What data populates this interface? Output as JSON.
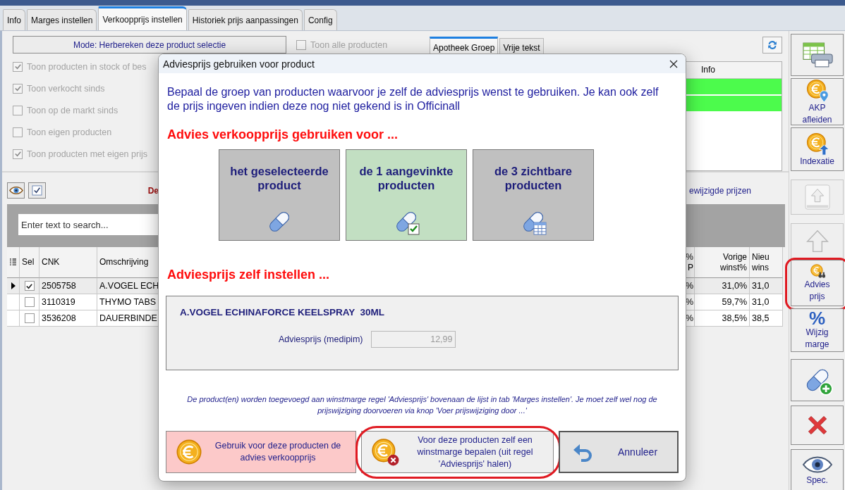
{
  "app_tabs": [
    {
      "label": "Info",
      "selected": false
    },
    {
      "label": "Marges instellen",
      "selected": false
    },
    {
      "label": "Verkoopprijs instellen",
      "selected": true
    },
    {
      "label": "Historiek prijs aanpassingen",
      "selected": false
    },
    {
      "label": "Config",
      "selected": false
    }
  ],
  "mode_button": "Mode: Herbereken deze product selectie",
  "show_all": {
    "label": "Toon alle producten",
    "checked": false,
    "disabled": true
  },
  "filters": [
    {
      "label": "Toon producten in stock of bes",
      "checked": true,
      "disabled": true
    },
    {
      "label": "Toon verkocht sinds",
      "checked": true,
      "disabled": true
    },
    {
      "label": "Toon op de markt sinds",
      "checked": false,
      "disabled": true
    },
    {
      "label": "Toon eigen producten",
      "checked": false,
      "disabled": true
    },
    {
      "label": "Toon producten met eigen prijs",
      "checked": true,
      "disabled": true
    }
  ],
  "group_tabs": [
    {
      "label": "Apotheek Groep",
      "selected": true
    },
    {
      "label": "Vrije tekst",
      "selected": false
    }
  ],
  "info_table": {
    "column": "Info",
    "rows": [
      {
        "color": "#4cfb4c"
      },
      {
        "color": "#4cfb4c"
      }
    ]
  },
  "list_toolbar": {
    "notice_start": "De",
    "notice_end": "ewijzigde prijzen"
  },
  "search": {
    "placeholder": "Enter text to search..."
  },
  "products": {
    "columns": [
      {
        "lines": [
          "Sel"
        ]
      },
      {
        "lines": [
          "CNK"
        ]
      },
      {
        "lines": [
          "Omschrijving"
        ]
      },
      {
        "lines": [
          "%",
          "P"
        ]
      },
      {
        "lines": [
          "Vorige",
          "winst%"
        ]
      },
      {
        "lines": [
          "Nieu",
          "wins"
        ]
      }
    ],
    "rows": [
      {
        "current": true,
        "checked": true,
        "cnk": "2505758",
        "description": "A.VOGEL ECH",
        "pct": "%",
        "previous": "31,0%",
        "new": "31,0"
      },
      {
        "current": false,
        "checked": false,
        "cnk": "3110319",
        "description": "THYMO TABS",
        "pct": "%",
        "previous": "59,7%",
        "new": "31,0"
      },
      {
        "current": false,
        "checked": false,
        "cnk": "3536208",
        "description": "DAUERBINDE",
        "pct": "%",
        "previous": "38,5%",
        "new": "38,5"
      }
    ]
  },
  "side_toolbar": [
    [
      {
        "kind": "print-table",
        "disabled": false
      },
      {
        "kind": "coin-pin",
        "lines": [
          "AKP",
          "afleiden"
        ],
        "disabled": false
      },
      {
        "kind": "coin-up",
        "lines": [
          "Indexatie"
        ],
        "disabled": false
      }
    ],
    [
      {
        "kind": "arrow-top",
        "disabled": true
      },
      {
        "kind": "arrow-up",
        "disabled": true
      },
      {
        "kind": "coin-binoculars",
        "lines": [
          "Advies",
          "prijs"
        ],
        "disabled": false,
        "circled": true
      },
      {
        "kind": "percent",
        "glyph": "%",
        "lines": [
          "Wijzig",
          "marge"
        ],
        "disabled": false
      },
      {
        "kind": "pill-add",
        "disabled": false
      },
      {
        "kind": "cross",
        "disabled": false
      },
      {
        "kind": "eye",
        "lines": [
          "Spec."
        ],
        "disabled": false
      }
    ]
  ],
  "dialog": {
    "title": "Adviesprijs gebruiken voor product",
    "intro": "Bepaal de groep van producten waarvoor je zelf de adviesprijs wenst te gebruiken. Je kan ook zelf de prijs ingeven indien deze nog niet gekend is in Officinall",
    "options_heading": "Advies verkoopprijs gebruiken voor ...",
    "options": [
      {
        "lines": [
          "het geselecteerde",
          "product"
        ],
        "kind": "pill",
        "selected": false
      },
      {
        "lines": [
          "de 1 aangevinkte",
          "producten"
        ],
        "kind": "pill-check",
        "selected": true
      },
      {
        "lines": [
          "de 3 zichtbare",
          "producten"
        ],
        "kind": "pill-table",
        "selected": false
      }
    ],
    "manual_heading": "Adviesprijs zelf instellen ...",
    "product_name": "A.VOGEL ECHINAFORCE KEELSPRAY  30ML",
    "price_label": "Adviesprijs (medipim)",
    "price_value": "12,99",
    "note": "De product(en) worden toegevoegd aan winstmarge regel 'Adviesprijs' bovenaan de lijst in tab 'Marges instellen'. Je moet zelf wel nog de prijswijziging doorvoeren via knop 'Voer prijswijziging door ...'",
    "buttons": [
      {
        "kind": "use",
        "text": "Gebruik voor deze producten de advies verkoopprijs"
      },
      {
        "kind": "own-margin",
        "text": "Voor deze producten zelf een winstmarge bepalen (uit regel 'Adviesprijs' halen)",
        "circled": true
      },
      {
        "kind": "cancel",
        "text": "Annuleer"
      }
    ]
  }
}
